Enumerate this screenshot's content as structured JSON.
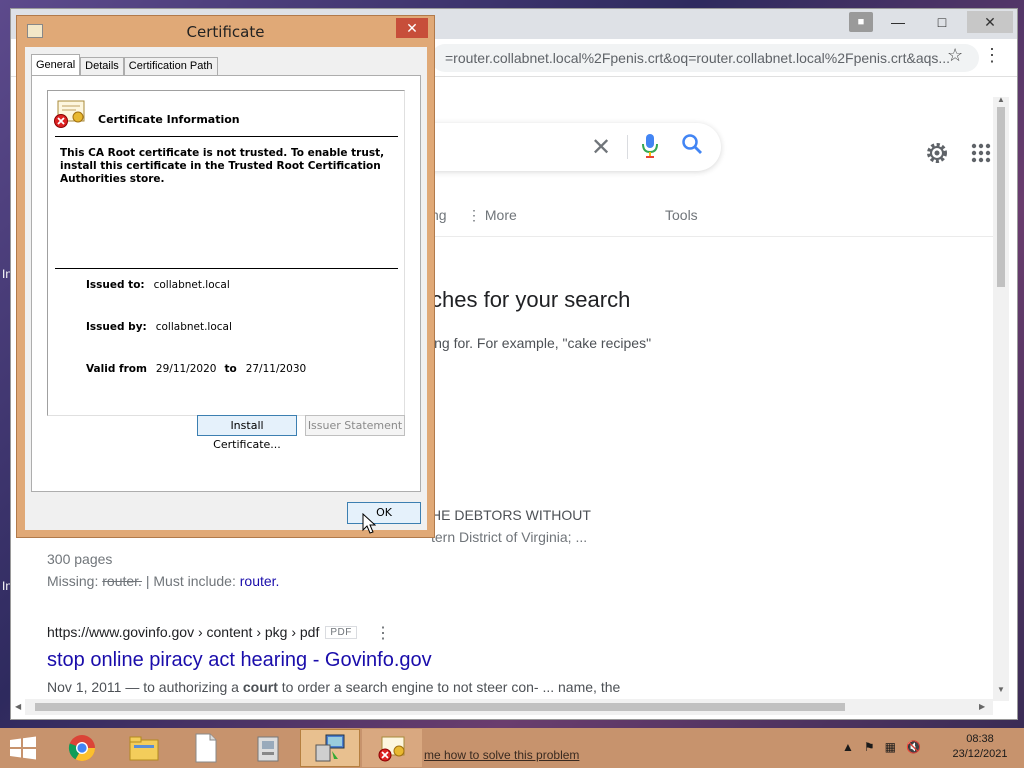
{
  "desktop": {
    "frag1": "In",
    "frag2": "In"
  },
  "browser": {
    "address": "=router.collabnet.local%2Fpenis.crt&oq=router.collabnet.local%2Fpenis.crt&aqs...",
    "nav_frag": "ng",
    "nav_more": "More",
    "nav_tools": "Tools",
    "heading_frag": "ches for your search",
    "hint_frag": "ing for. For example, \"cake recipes\"",
    "res1_line1": "HE DEBTORS WITHOUT",
    "res1_line2": "tern District of Virginia; ...",
    "pages": "300 pages",
    "missing_label": "Missing:",
    "missing_struck": "router.",
    "must_include": "| Must include:",
    "must_word": "router.",
    "result_url": "https://www.govinfo.gov › content › pkg › pdf",
    "pdf_badge": "PDF",
    "result_title": "stop online piracy act hearing - Govinfo.gov",
    "snippet_pre": "Nov 1, 2011 — to authorizing a ",
    "snippet_bold": "court",
    "snippet_post": " to order a search engine to not steer con- ... name, the"
  },
  "dialog": {
    "title": "Certificate",
    "tabs": [
      "General",
      "Details",
      "Certification Path"
    ],
    "info_heading": "Certificate Information",
    "warning": "This CA Root certificate is not trusted. To enable trust, install this certificate in the Trusted Root Certification Authorities store.",
    "issued_to_label": "Issued to:",
    "issued_to": "collabnet.local",
    "issued_by_label": "Issued by:",
    "issued_by": "collabnet.local",
    "valid_from_label": "Valid from",
    "valid_from": "29/11/2020",
    "to_label": "to",
    "valid_to": "27/11/2030",
    "install_btn": "Install Certificate...",
    "issuer_btn": "Issuer Statement",
    "ok_btn": "OK"
  },
  "taskbar": {
    "link": "me how to solve this problem",
    "time": "08:38",
    "date": "23/12/2021"
  }
}
